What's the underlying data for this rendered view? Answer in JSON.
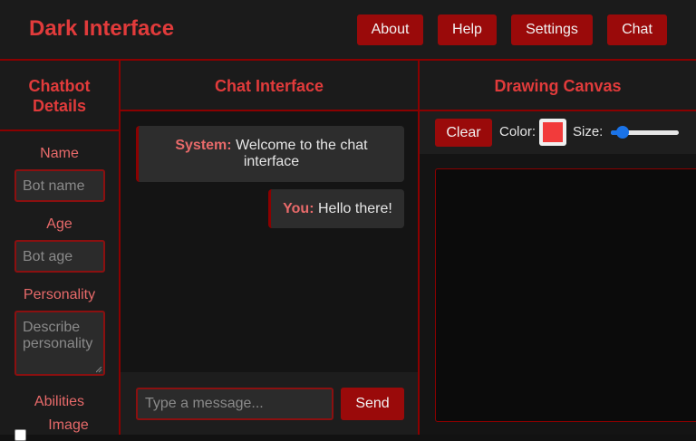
{
  "header": {
    "brand": "Dark Interface",
    "nav": [
      {
        "label": "About"
      },
      {
        "label": "Help"
      },
      {
        "label": "Settings"
      },
      {
        "label": "Chat"
      }
    ]
  },
  "sidebar": {
    "title_line1": "Chatbot",
    "title_line2": "Details",
    "name_label": "Name",
    "name_placeholder": "Bot name",
    "age_label": "Age",
    "age_placeholder": "Bot age",
    "personality_label": "Personality",
    "personality_placeholder_line1": "Describe",
    "personality_placeholder_line2": "personality",
    "abilities_label": "Abilities",
    "ability_image": "Image"
  },
  "chat": {
    "title": "Chat Interface",
    "messages": [
      {
        "sender": "System:",
        "text_line1": "Welcome to the chat",
        "text_line2": "interface"
      },
      {
        "sender": "You:",
        "text": "Hello there!"
      }
    ],
    "input_placeholder": "Type a message...",
    "send_label": "Send"
  },
  "canvas": {
    "title": "Drawing Canvas",
    "clear_label": "Clear",
    "color_label": "Color:",
    "size_label": "Size:",
    "selected_color": "#f23b3b",
    "size_level_fraction": 0.12
  },
  "colors": {
    "accent": "#e13b3b",
    "button_bg": "#9a0a0a",
    "border": "#8b0000",
    "slider": "#1a73e8"
  }
}
